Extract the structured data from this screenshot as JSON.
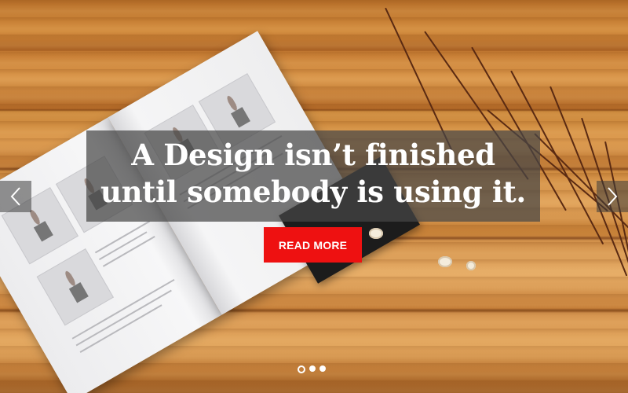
{
  "slide": {
    "headline_line1": "A Design isn’t finished",
    "headline_line2": "until somebody is using it.",
    "cta_label": "READ MORE"
  },
  "navigation": {
    "prev_icon": "chevron-left-icon",
    "next_icon": "chevron-right-icon"
  },
  "pagination": {
    "total": 3,
    "active_index": 0
  },
  "colors": {
    "cta_background": "#ee1111",
    "overlay": "#464646",
    "text": "#ffffff"
  }
}
